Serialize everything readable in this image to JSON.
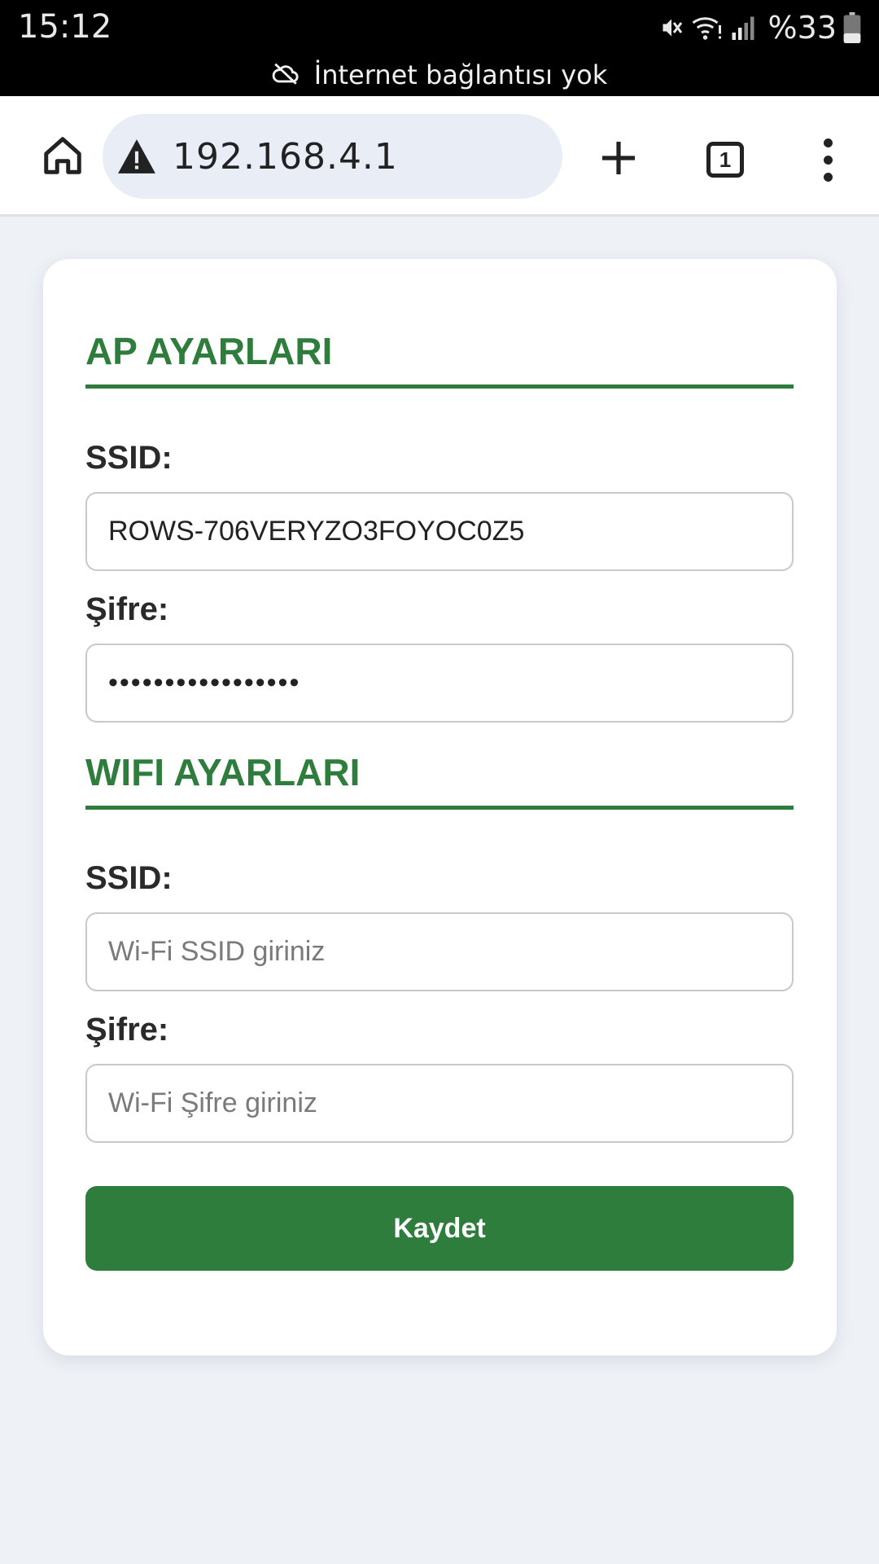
{
  "status_bar": {
    "time": "15:12",
    "battery": "%33",
    "offline_message": "İnternet bağlantısı yok",
    "icons": [
      "mute-icon",
      "wifi-icon",
      "signal-icon",
      "battery-icon",
      "cloud-off-icon"
    ]
  },
  "browser": {
    "url": "192.168.4.1",
    "tab_count": "1",
    "icons": [
      "home-icon",
      "warning-icon",
      "plus-icon",
      "tabs-icon",
      "more-vert-icon"
    ]
  },
  "form": {
    "ap": {
      "title": "AP AYARLARI",
      "ssid_label": "SSID:",
      "ssid_value": "ROWS-706VERYZO3FOYOC0Z5",
      "password_label": "Şifre:",
      "password_value": "•••••••••••••••••"
    },
    "wifi": {
      "title": "WIFI AYARLARI",
      "ssid_label": "SSID:",
      "ssid_placeholder": "Wi-Fi SSID giriniz",
      "password_label": "Şifre:",
      "password_placeholder": "Wi-Fi Şifre giriniz"
    },
    "save_label": "Kaydet"
  },
  "colors": {
    "accent": "#2e7d3c",
    "page_background": "#eef2f7",
    "url_bar": "#e8edf6"
  }
}
